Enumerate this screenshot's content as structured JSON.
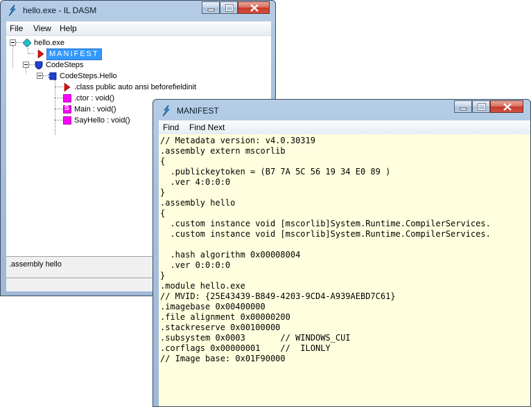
{
  "main_window": {
    "title": "hello.exe - IL DASM",
    "menu": [
      "File",
      "View",
      "Help"
    ],
    "tree": [
      {
        "label": "hello.exe",
        "icon": "assembly-diamond-icon"
      },
      {
        "label": "MANIFEST",
        "icon": "manifest-triangle-icon"
      },
      {
        "label": "CodeSteps",
        "icon": "namespace-shield-icon"
      },
      {
        "label": "CodeSteps.Hello",
        "icon": "class-icon"
      },
      {
        "label": ".class public auto ansi beforefieldinit",
        "icon": "class-info-triangle-icon"
      },
      {
        "label": ".ctor : void()",
        "icon": "method-icon"
      },
      {
        "label": "Main : void()",
        "icon": "static-method-icon"
      },
      {
        "label": "SayHello : void()",
        "icon": "method-icon"
      }
    ],
    "static_badge": "S",
    "status": ".assembly hello"
  },
  "manifest_window": {
    "title": "MANIFEST",
    "menu": [
      "Find",
      "Find Next"
    ],
    "lines": [
      "// Metadata version: v4.0.30319",
      ".assembly extern mscorlib",
      "{",
      "  .publickeytoken = (B7 7A 5C 56 19 34 E0 89 )",
      "  .ver 4:0:0:0",
      "}",
      ".assembly hello",
      "{",
      "  .custom instance void [mscorlib]System.Runtime.CompilerServices.",
      "  .custom instance void [mscorlib]System.Runtime.CompilerServices.",
      "",
      "  .hash algorithm 0x00008004",
      "  .ver 0:0:0:0",
      "}",
      ".module hello.exe",
      "// MVID: {25E43439-B849-4203-9CD4-A939AEBD7C61}",
      ".imagebase 0x00400000",
      ".file alignment 0x00000200",
      ".stackreserve 0x00100000",
      ".subsystem 0x0003       // WINDOWS_CUI",
      ".corflags 0x00000001    //  ILONLY",
      "// Image base: 0x01F90000"
    ]
  },
  "colors": {
    "selection": "#3399ff",
    "code_background": "#ffffdf",
    "method_icon": "#ff00ff",
    "class_icon": "#2040d0",
    "assembly_icon": "#20c0d0",
    "manifest_icon": "#e01010"
  }
}
